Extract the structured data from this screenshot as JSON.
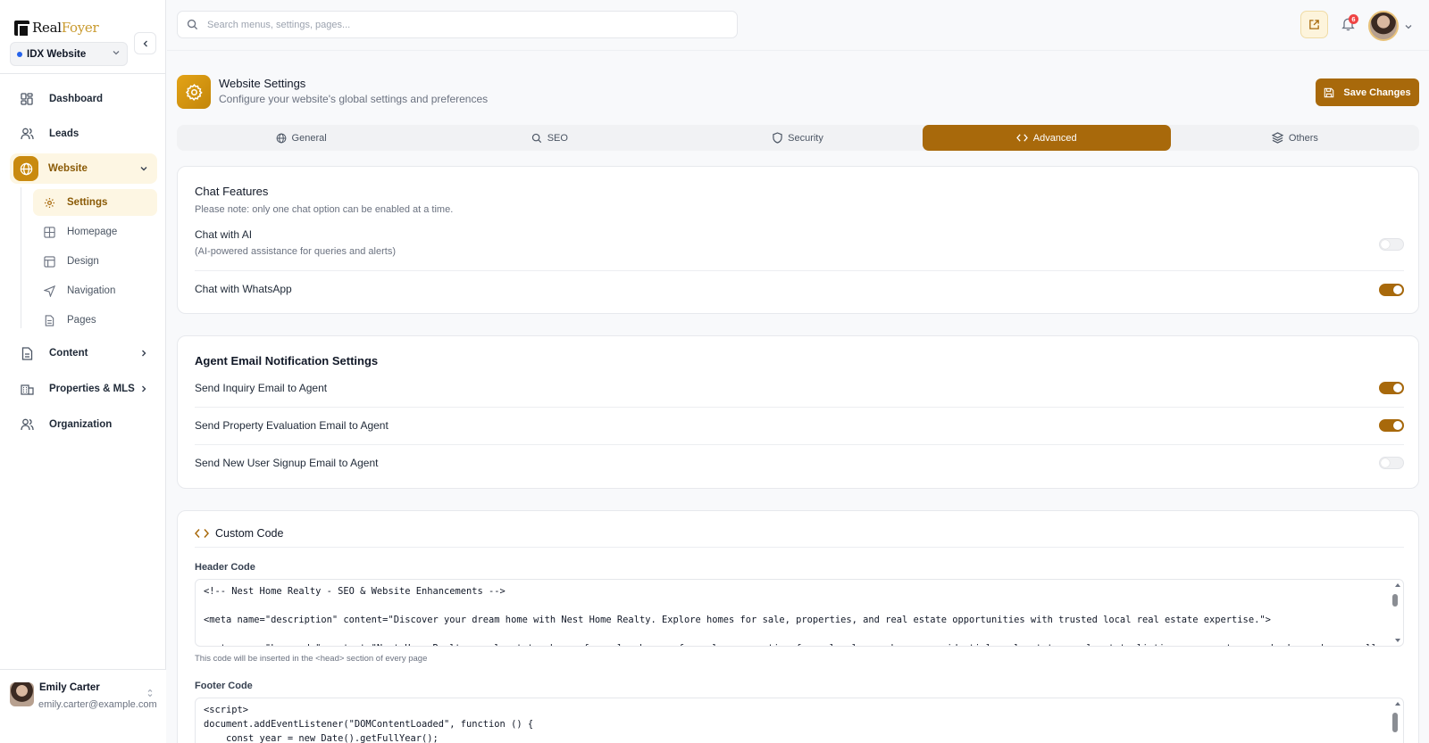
{
  "app": {
    "logo_real": "Real",
    "logo_foyer": "Foyer",
    "site_selector": "IDX Website"
  },
  "sidebar": {
    "items": [
      {
        "label": "Dashboard",
        "icon": "dashboard-icon"
      },
      {
        "label": "Leads",
        "icon": "users-icon"
      },
      {
        "label": "Website",
        "icon": "globe-icon"
      },
      {
        "label": "Content",
        "icon": "document-icon"
      },
      {
        "label": "Properties & MLS",
        "icon": "building-icon"
      },
      {
        "label": "Organization",
        "icon": "users-icon"
      }
    ],
    "website_sub": [
      {
        "label": "Settings",
        "icon": "gear-icon"
      },
      {
        "label": "Homepage",
        "icon": "grid-icon"
      },
      {
        "label": "Design",
        "icon": "layout-icon"
      },
      {
        "label": "Navigation",
        "icon": "navigation-icon"
      },
      {
        "label": "Pages",
        "icon": "file-icon"
      }
    ]
  },
  "user": {
    "name": "Emily Carter",
    "email": "emily.carter@example.com"
  },
  "topbar": {
    "search_placeholder": "Search menus, settings, pages...",
    "notification_count": "6"
  },
  "header": {
    "title": "Website Settings",
    "subtitle": "Configure your website's global settings and preferences",
    "save_label": "Save Changes"
  },
  "tabs": [
    {
      "label": "General",
      "icon": "globe-icon",
      "active": false
    },
    {
      "label": "SEO",
      "icon": "search-icon",
      "active": false
    },
    {
      "label": "Security",
      "icon": "shield-icon",
      "active": false
    },
    {
      "label": "Advanced",
      "icon": "code-icon",
      "active": true
    },
    {
      "label": "Others",
      "icon": "layers-icon",
      "active": false
    }
  ],
  "chat": {
    "title": "Chat Features",
    "note": "Please note: only one chat option can be enabled at a time.",
    "ai_label": "Chat with AI",
    "ai_desc": "(AI-powered assistance for queries and alerts)",
    "ai_enabled": false,
    "whatsapp_label": "Chat with WhatsApp",
    "whatsapp_enabled": true
  },
  "agent_email": {
    "title": "Agent Email Notification Settings",
    "inquiry_label": "Send Inquiry Email to Agent",
    "inquiry_enabled": true,
    "evaluation_label": "Send Property Evaluation Email to Agent",
    "evaluation_enabled": true,
    "signup_label": "Send New User Signup Email to Agent",
    "signup_enabled": false
  },
  "custom_code": {
    "title": "Custom Code",
    "header_label": "Header Code",
    "header_code": "<!-- Nest Home Realty - SEO & Website Enhancements -->\n\n<meta name=\"description\" content=\"Discover your dream home with Nest Home Realty. Explore homes for sale, properties, and real estate opportunities with trusted local real estate expertise.\">\n\n<meta name=\"keywords\" content=\"Nest Home Realty, real estate, homes for sale, houses for sale, properties for sale, luxury homes, residential real estate, real estate listings, property search, buy a home, sell",
    "header_hint": "This code will be inserted in the <head> section of every page",
    "footer_label": "Footer Code",
    "footer_code": "<script>\ndocument.addEventListener(\"DOMContentLoaded\", function () {\n    const year = new Date().getFullYear();"
  },
  "colors": {
    "accent": "#a8690b",
    "accent_light": "#fdf6e3",
    "badge": "#ef4444"
  }
}
